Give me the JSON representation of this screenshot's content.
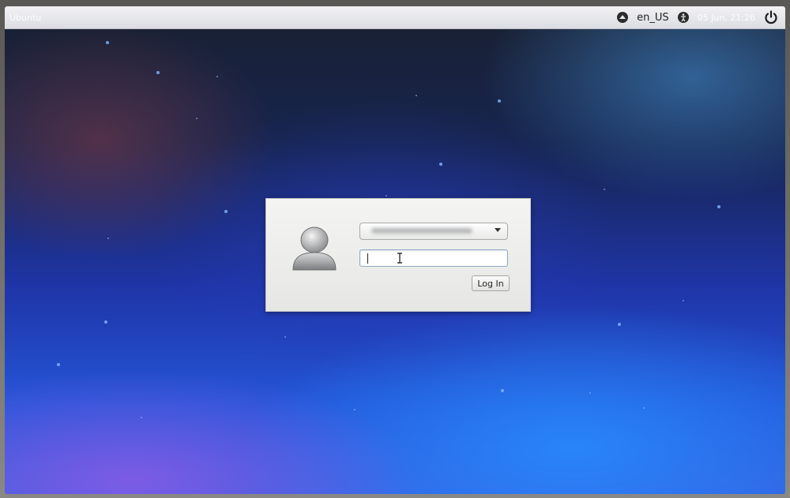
{
  "panel": {
    "host_label": "Ubuntu",
    "language": "en_US",
    "clock": "05 Jun, 21:26",
    "icons": {
      "session": "session-icon",
      "accessibility": "accessibility-icon",
      "power": "power-icon"
    }
  },
  "login": {
    "username_value": "",
    "password_value": "",
    "login_button_label": "Log In",
    "avatar_icon": "user-avatar-icon"
  },
  "colors": {
    "panel": "#e6e7ea",
    "dialog": "#ecedea",
    "wallpaper_top": "#1a2030",
    "wallpaper_bottom": "#2456d8"
  }
}
